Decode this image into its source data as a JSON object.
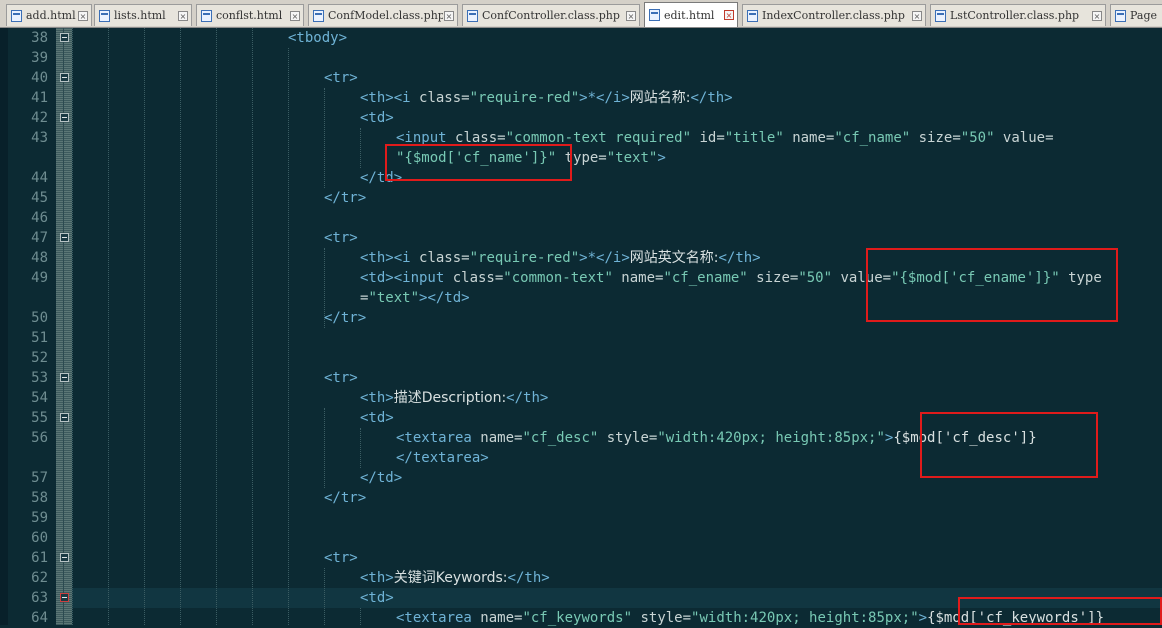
{
  "tabs": [
    {
      "label": "add.html",
      "active": false
    },
    {
      "label": "lists.html",
      "active": false
    },
    {
      "label": "conflst.html",
      "active": false
    },
    {
      "label": "ConfModel.class.php",
      "active": false
    },
    {
      "label": "ConfController.class.php",
      "active": false
    },
    {
      "label": "edit.html",
      "active": true
    },
    {
      "label": "IndexController.class.php",
      "active": false
    },
    {
      "label": "LstController.class.php",
      "active": false
    },
    {
      "label": "Page",
      "active": false
    }
  ],
  "tab_close_glyph": "×",
  "line_numbers": [
    "38",
    "39",
    "40",
    "41",
    "42",
    "43",
    "44",
    "45",
    "46",
    "47",
    "48",
    "49",
    "50",
    "51",
    "52",
    "53",
    "54",
    "55",
    "56",
    "57",
    "58",
    "59",
    "60",
    "61",
    "62",
    "63",
    "64"
  ],
  "code": {
    "l38": {
      "t1": "<tbody>"
    },
    "l40": {
      "t1": "<tr>"
    },
    "l41": {
      "t1": "<th><i ",
      "a1": "class=",
      "s1": "\"require-red\"",
      "t2": ">*</i>",
      "x1": "网站名称:",
      "t3": "</th>"
    },
    "l42": {
      "t1": "<td>"
    },
    "l43": {
      "t1": "<input ",
      "a1": "class=",
      "s1": "\"common-text required\"",
      "a2": " id=",
      "s2": "\"title\"",
      "a3": " name=",
      "s3": "\"cf_name\"",
      "a4": " size=",
      "s4": "\"50\"",
      "a5": " value="
    },
    "l43w": {
      "s1": "\"{$mod['cf_name']}\"",
      "a1": " type=",
      "s2": "\"text\"",
      "t1": ">"
    },
    "l44": {
      "t1": "</td>"
    },
    "l45": {
      "t1": "</tr>"
    },
    "l47": {
      "t1": "<tr>"
    },
    "l48": {
      "t1": "<th><i ",
      "a1": "class=",
      "s1": "\"require-red\"",
      "t2": ">*</i>",
      "x1": "网站英文名称:",
      "t3": "</th>"
    },
    "l49": {
      "t1": "<td><input ",
      "a1": "class=",
      "s1": "\"common-text\"",
      "a2": " name=",
      "s2": "\"cf_ename\"",
      "a3": " size=",
      "s3": "\"50\"",
      "a4": " value=",
      "s4": "\"{$mod['cf_ename']}\"",
      "a5": " type"
    },
    "l49w": {
      "a1": "=",
      "s1": "\"text\"",
      "t1": "></td>"
    },
    "l50": {
      "t1": "</tr>"
    },
    "l53": {
      "t1": "<tr>"
    },
    "l54": {
      "t1": "<th>",
      "x1": "描述Description:",
      "t2": "</th>"
    },
    "l55": {
      "t1": "<td>"
    },
    "l56": {
      "t1": "<textarea ",
      "a1": "name=",
      "s1": "\"cf_desc\"",
      "a2": " style=",
      "s2": "\"width:420px; height:85px;\"",
      "t2": ">",
      "x1": "{$mod['cf_desc']}"
    },
    "l56w": {
      "t1": "</textarea>"
    },
    "l57": {
      "t1": "</td>"
    },
    "l58": {
      "t1": "</tr>"
    },
    "l61": {
      "t1": "<tr>"
    },
    "l62": {
      "t1": "<th>",
      "x1": "关键词Keywords:",
      "t2": "</th>"
    },
    "l63": {
      "t1": "<td>"
    },
    "l64": {
      "t1": "<textarea ",
      "a1": "name=",
      "s1": "\"cf_keywords\"",
      "a2": " style=",
      "s2": "\"width:420px; height:85px;\"",
      "t2": ">",
      "x1": "{$mod['cf_keywords']}"
    }
  },
  "colors": {
    "background": "#0c2a33",
    "tag": "#6fb3d6",
    "string": "#78c9b4",
    "annotation": "#e01b1b"
  }
}
